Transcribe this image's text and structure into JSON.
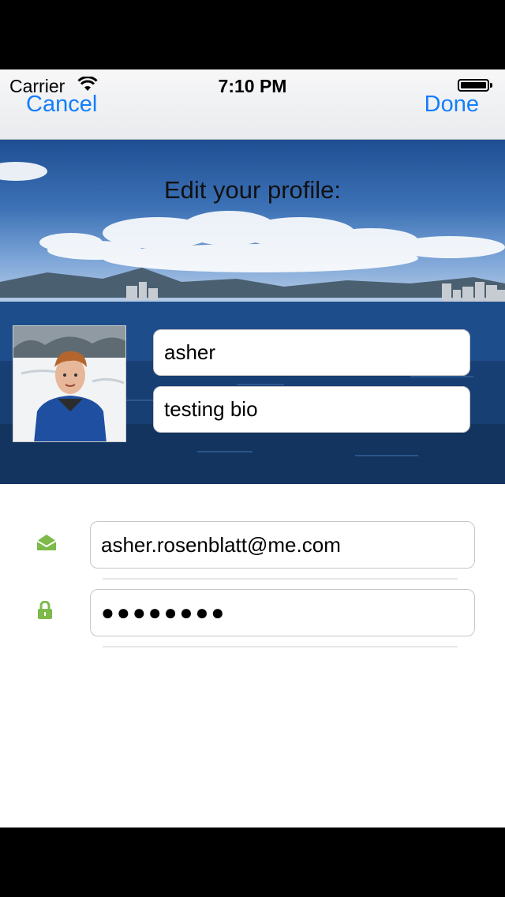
{
  "status_bar": {
    "carrier": "Carrier",
    "time": "7:10 PM"
  },
  "nav": {
    "cancel": "Cancel",
    "done": "Done"
  },
  "profile": {
    "title": "Edit your profile:",
    "name_value": "asher",
    "bio_value": "testing bio"
  },
  "account": {
    "email_value": "asher.rosenblatt@me.com",
    "password_value": "●●●●●●●●"
  },
  "icons": {
    "email": "envelope-open-icon",
    "password": "lock-icon",
    "accent": "#7dba4a",
    "link": "#147efb"
  }
}
